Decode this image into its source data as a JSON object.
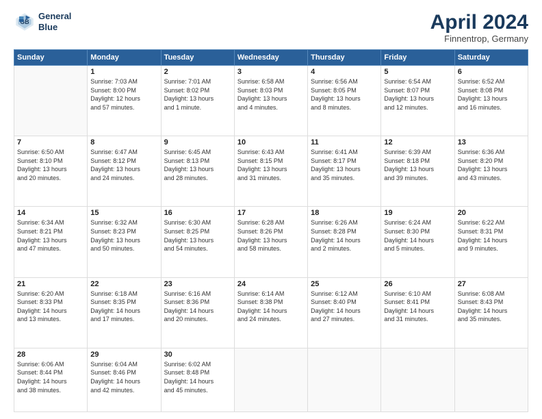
{
  "header": {
    "logo_line1": "General",
    "logo_line2": "Blue",
    "month": "April 2024",
    "location": "Finnentrop, Germany"
  },
  "days_of_week": [
    "Sunday",
    "Monday",
    "Tuesday",
    "Wednesday",
    "Thursday",
    "Friday",
    "Saturday"
  ],
  "weeks": [
    [
      {
        "num": "",
        "info": ""
      },
      {
        "num": "1",
        "info": "Sunrise: 7:03 AM\nSunset: 8:00 PM\nDaylight: 12 hours\nand 57 minutes."
      },
      {
        "num": "2",
        "info": "Sunrise: 7:01 AM\nSunset: 8:02 PM\nDaylight: 13 hours\nand 1 minute."
      },
      {
        "num": "3",
        "info": "Sunrise: 6:58 AM\nSunset: 8:03 PM\nDaylight: 13 hours\nand 4 minutes."
      },
      {
        "num": "4",
        "info": "Sunrise: 6:56 AM\nSunset: 8:05 PM\nDaylight: 13 hours\nand 8 minutes."
      },
      {
        "num": "5",
        "info": "Sunrise: 6:54 AM\nSunset: 8:07 PM\nDaylight: 13 hours\nand 12 minutes."
      },
      {
        "num": "6",
        "info": "Sunrise: 6:52 AM\nSunset: 8:08 PM\nDaylight: 13 hours\nand 16 minutes."
      }
    ],
    [
      {
        "num": "7",
        "info": "Sunrise: 6:50 AM\nSunset: 8:10 PM\nDaylight: 13 hours\nand 20 minutes."
      },
      {
        "num": "8",
        "info": "Sunrise: 6:47 AM\nSunset: 8:12 PM\nDaylight: 13 hours\nand 24 minutes."
      },
      {
        "num": "9",
        "info": "Sunrise: 6:45 AM\nSunset: 8:13 PM\nDaylight: 13 hours\nand 28 minutes."
      },
      {
        "num": "10",
        "info": "Sunrise: 6:43 AM\nSunset: 8:15 PM\nDaylight: 13 hours\nand 31 minutes."
      },
      {
        "num": "11",
        "info": "Sunrise: 6:41 AM\nSunset: 8:17 PM\nDaylight: 13 hours\nand 35 minutes."
      },
      {
        "num": "12",
        "info": "Sunrise: 6:39 AM\nSunset: 8:18 PM\nDaylight: 13 hours\nand 39 minutes."
      },
      {
        "num": "13",
        "info": "Sunrise: 6:36 AM\nSunset: 8:20 PM\nDaylight: 13 hours\nand 43 minutes."
      }
    ],
    [
      {
        "num": "14",
        "info": "Sunrise: 6:34 AM\nSunset: 8:21 PM\nDaylight: 13 hours\nand 47 minutes."
      },
      {
        "num": "15",
        "info": "Sunrise: 6:32 AM\nSunset: 8:23 PM\nDaylight: 13 hours\nand 50 minutes."
      },
      {
        "num": "16",
        "info": "Sunrise: 6:30 AM\nSunset: 8:25 PM\nDaylight: 13 hours\nand 54 minutes."
      },
      {
        "num": "17",
        "info": "Sunrise: 6:28 AM\nSunset: 8:26 PM\nDaylight: 13 hours\nand 58 minutes."
      },
      {
        "num": "18",
        "info": "Sunrise: 6:26 AM\nSunset: 8:28 PM\nDaylight: 14 hours\nand 2 minutes."
      },
      {
        "num": "19",
        "info": "Sunrise: 6:24 AM\nSunset: 8:30 PM\nDaylight: 14 hours\nand 5 minutes."
      },
      {
        "num": "20",
        "info": "Sunrise: 6:22 AM\nSunset: 8:31 PM\nDaylight: 14 hours\nand 9 minutes."
      }
    ],
    [
      {
        "num": "21",
        "info": "Sunrise: 6:20 AM\nSunset: 8:33 PM\nDaylight: 14 hours\nand 13 minutes."
      },
      {
        "num": "22",
        "info": "Sunrise: 6:18 AM\nSunset: 8:35 PM\nDaylight: 14 hours\nand 17 minutes."
      },
      {
        "num": "23",
        "info": "Sunrise: 6:16 AM\nSunset: 8:36 PM\nDaylight: 14 hours\nand 20 minutes."
      },
      {
        "num": "24",
        "info": "Sunrise: 6:14 AM\nSunset: 8:38 PM\nDaylight: 14 hours\nand 24 minutes."
      },
      {
        "num": "25",
        "info": "Sunrise: 6:12 AM\nSunset: 8:40 PM\nDaylight: 14 hours\nand 27 minutes."
      },
      {
        "num": "26",
        "info": "Sunrise: 6:10 AM\nSunset: 8:41 PM\nDaylight: 14 hours\nand 31 minutes."
      },
      {
        "num": "27",
        "info": "Sunrise: 6:08 AM\nSunset: 8:43 PM\nDaylight: 14 hours\nand 35 minutes."
      }
    ],
    [
      {
        "num": "28",
        "info": "Sunrise: 6:06 AM\nSunset: 8:44 PM\nDaylight: 14 hours\nand 38 minutes."
      },
      {
        "num": "29",
        "info": "Sunrise: 6:04 AM\nSunset: 8:46 PM\nDaylight: 14 hours\nand 42 minutes."
      },
      {
        "num": "30",
        "info": "Sunrise: 6:02 AM\nSunset: 8:48 PM\nDaylight: 14 hours\nand 45 minutes."
      },
      {
        "num": "",
        "info": ""
      },
      {
        "num": "",
        "info": ""
      },
      {
        "num": "",
        "info": ""
      },
      {
        "num": "",
        "info": ""
      }
    ]
  ]
}
